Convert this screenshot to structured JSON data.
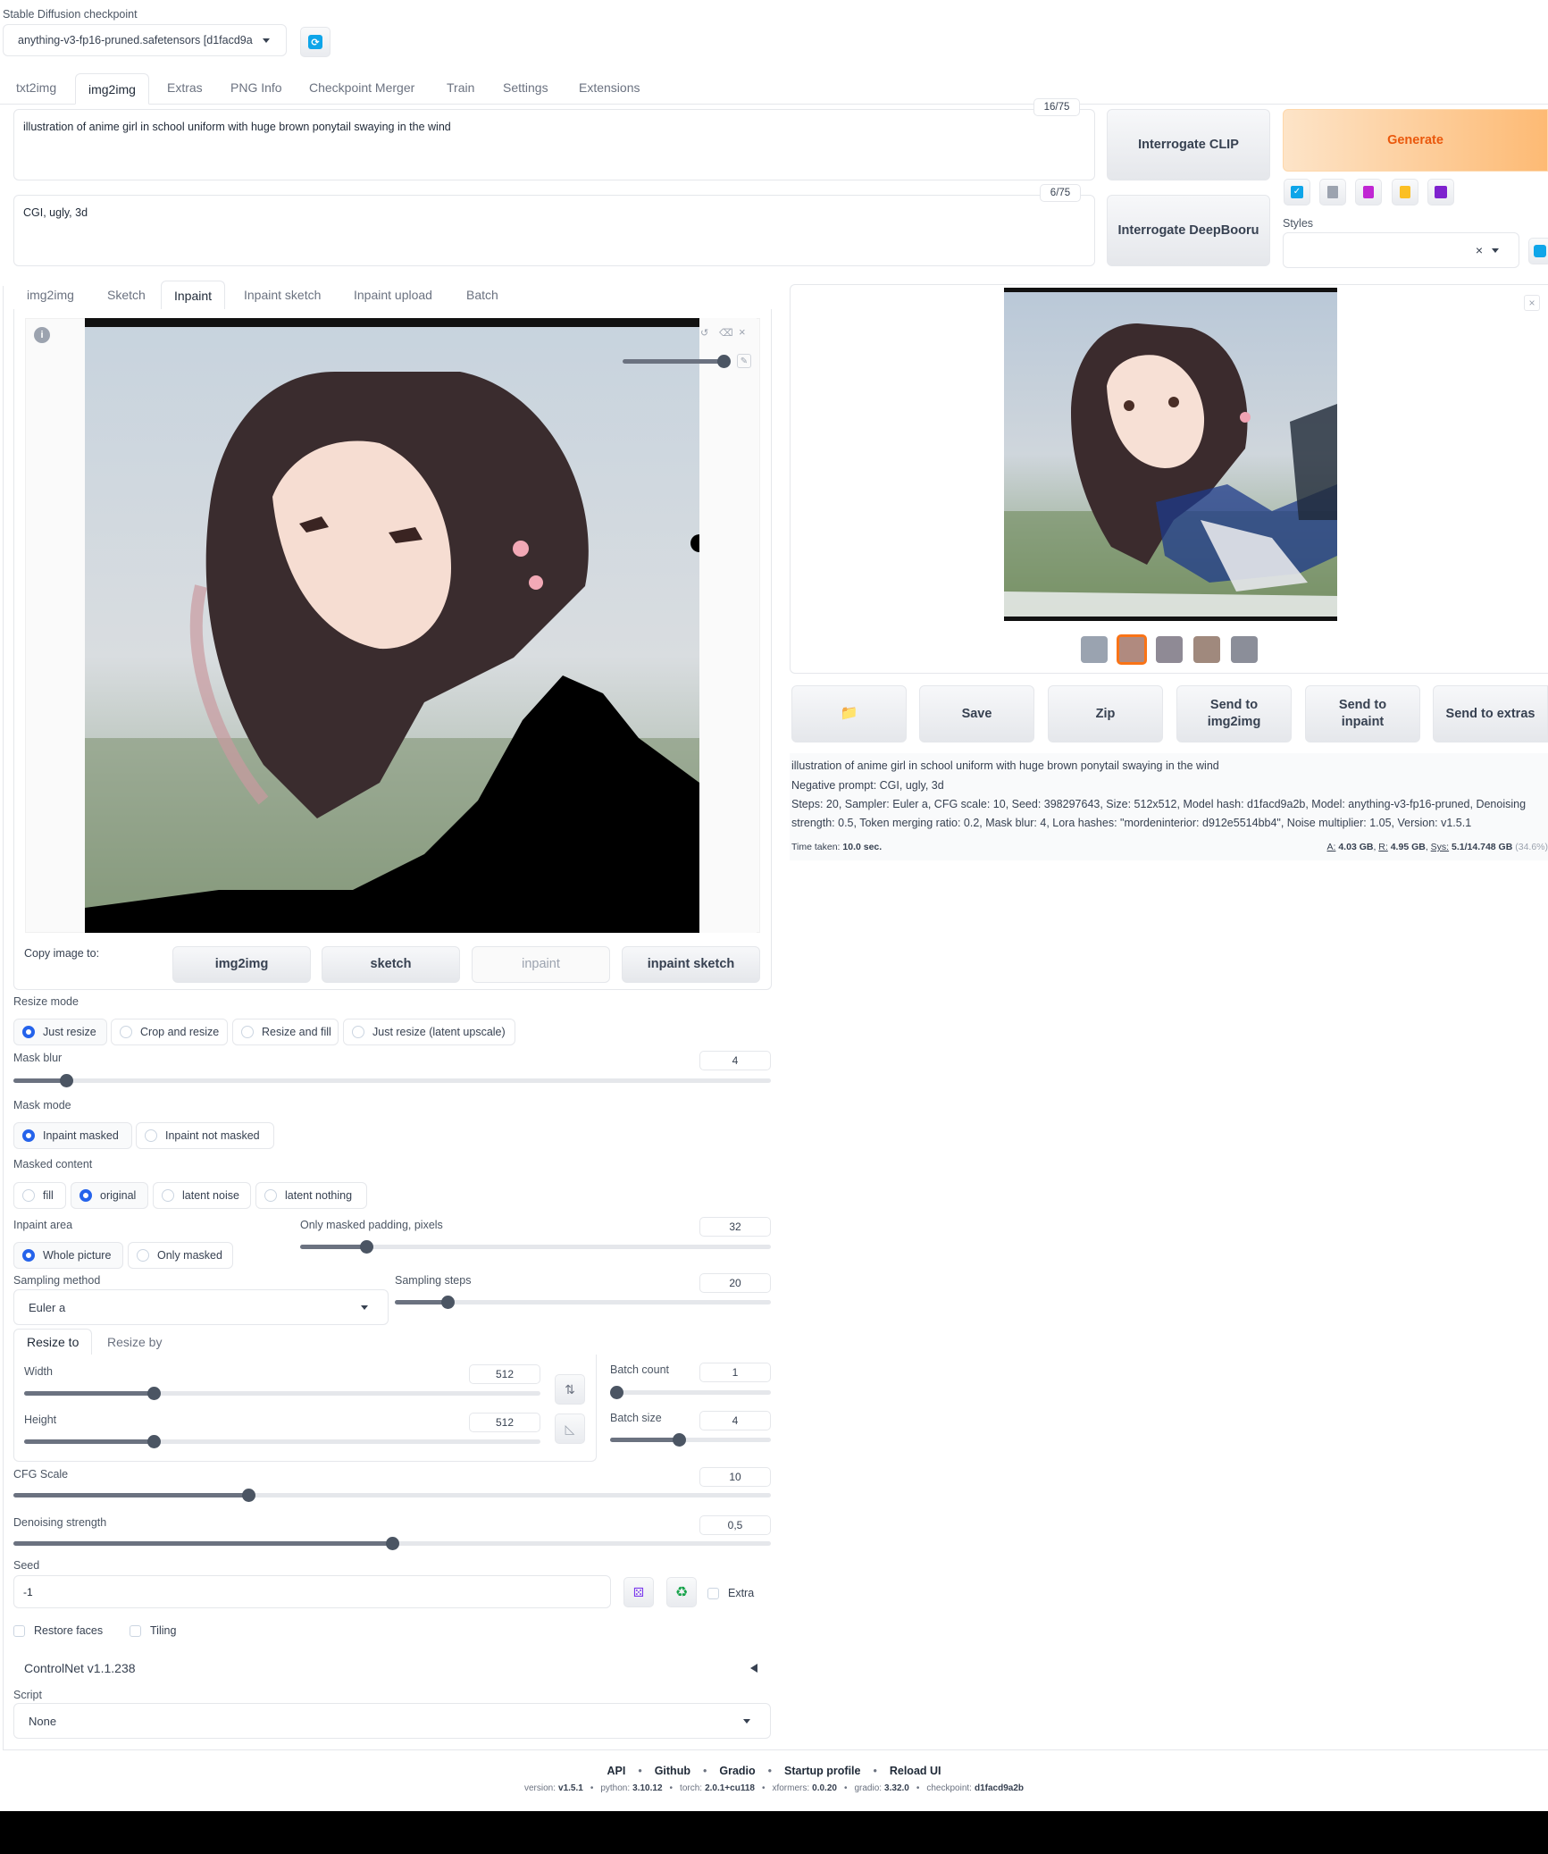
{
  "checkpoint": {
    "label": "Stable Diffusion checkpoint",
    "value": "anything-v3-fp16-pruned.safetensors [d1facd9a"
  },
  "main_tabs": [
    "txt2img",
    "img2img",
    "Extras",
    "PNG Info",
    "Checkpoint Merger",
    "Train",
    "Settings",
    "Extensions"
  ],
  "prompt": {
    "text": "illustration of anime girl in school uniform with huge brown ponytail swaying in the wind",
    "counter": "16/75"
  },
  "negative_prompt": {
    "text": "CGI, ugly, 3d",
    "counter": "6/75"
  },
  "buttons": {
    "interrogate_clip": "Interrogate CLIP",
    "interrogate_deepbooru": "Interrogate DeepBooru",
    "generate": "Generate"
  },
  "styles": {
    "label": "Styles",
    "clear": "×"
  },
  "sub_tabs": [
    "img2img",
    "Sketch",
    "Inpaint",
    "Inpaint sketch",
    "Inpaint upload",
    "Batch"
  ],
  "copy_image": {
    "label": "Copy image to:",
    "buttons": [
      "img2img",
      "sketch",
      "inpaint",
      "inpaint sketch"
    ]
  },
  "resize_mode": {
    "label": "Resize mode",
    "options": [
      "Just resize",
      "Crop and resize",
      "Resize and fill",
      "Just resize (latent upscale)"
    ],
    "selected": 0
  },
  "mask_blur": {
    "label": "Mask blur",
    "value": "4",
    "fraction": 0.07
  },
  "mask_mode": {
    "label": "Mask mode",
    "options": [
      "Inpaint masked",
      "Inpaint not masked"
    ],
    "selected": 0
  },
  "masked_content": {
    "label": "Masked content",
    "options": [
      "fill",
      "original",
      "latent noise",
      "latent nothing"
    ],
    "selected": 1
  },
  "inpaint_area": {
    "label": "Inpaint area",
    "options": [
      "Whole picture",
      "Only masked"
    ],
    "selected": 0
  },
  "padding": {
    "label": "Only masked padding, pixels",
    "value": "32",
    "fraction": 0.14
  },
  "sampling_method": {
    "label": "Sampling method",
    "value": "Euler a"
  },
  "sampling_steps": {
    "label": "Sampling steps",
    "value": "20",
    "fraction": 0.14
  },
  "size_tabs": [
    "Resize to",
    "Resize by"
  ],
  "width": {
    "label": "Width",
    "value": "512",
    "fraction": 0.25
  },
  "height": {
    "label": "Height",
    "value": "512",
    "fraction": 0.25
  },
  "batch_count": {
    "label": "Batch count",
    "value": "1",
    "fraction": 0.0
  },
  "batch_size": {
    "label": "Batch size",
    "value": "4",
    "fraction": 0.43
  },
  "cfg_scale": {
    "label": "CFG Scale",
    "value": "10",
    "fraction": 0.31
  },
  "denoising": {
    "label": "Denoising strength",
    "value": "0,5",
    "fraction": 0.5
  },
  "seed": {
    "label": "Seed",
    "value": "-1",
    "extra": "Extra"
  },
  "restore_faces": "Restore faces",
  "tiling": "Tiling",
  "controlnet": "ControlNet v1.1.238",
  "script": {
    "label": "Script",
    "value": "None"
  },
  "output_buttons": {
    "folder": "📁",
    "save": "Save",
    "zip": "Zip",
    "send_img2img": "Send to img2img",
    "send_inpaint": "Send to inpaint",
    "send_extras": "Send to extras"
  },
  "gen_info": {
    "prompt": "illustration of anime girl in school uniform with huge brown ponytail swaying in the wind",
    "negative": "Negative prompt: CGI, ugly, 3d",
    "params1": "Steps: 20, Sampler: Euler a, CFG scale: 10, Seed: 398297643, Size: 512x512, Model hash: d1facd9a2b, Model: anything-v3-fp16-pruned, Denoising",
    "params2": "strength: 0.5, Token merging ratio: 0.2, Mask blur: 4, Lora hashes: \"mordeninterior: d912e5514bb4\", Noise multiplier: 1.05, Version: v1.5.1"
  },
  "time_info": {
    "label": "Time taken:",
    "value": "10.0 sec.",
    "mem_a_label": "A:",
    "mem_a": "4.03 GB",
    "mem_r_label": "R:",
    "mem_r": "4.95 GB",
    "mem_sys_label": "Sys:",
    "mem_sys": "5.1/14.748 GB",
    "mem_pct": "(34.6%)"
  },
  "footer_links": [
    "API",
    "Github",
    "Gradio",
    "Startup profile",
    "Reload UI"
  ],
  "footer_versions": [
    {
      "label": "version:",
      "value": "v1.5.1"
    },
    {
      "label": "python:",
      "value": "3.10.12"
    },
    {
      "label": "torch:",
      "value": "2.0.1+cu118"
    },
    {
      "label": "xformers:",
      "value": "0.0.20"
    },
    {
      "label": "gradio:",
      "value": "3.32.0"
    },
    {
      "label": "checkpoint:",
      "value": "d1facd9a2b"
    }
  ],
  "colors": {
    "accent": "#2563eb",
    "generate_bg": "#fed7aa",
    "generate_text": "#ea580c",
    "orange_ring": "#f97316"
  }
}
